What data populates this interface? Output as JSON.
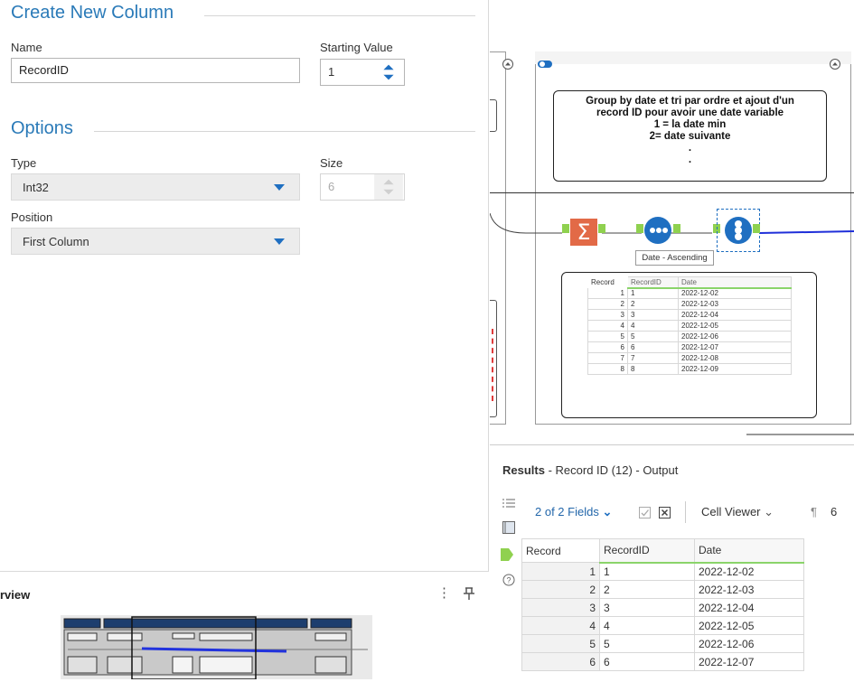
{
  "config": {
    "section1_title": "Create New Column",
    "name_label": "Name",
    "name_value": "RecordID",
    "starting_value_label": "Starting Value",
    "starting_value": "1",
    "section2_title": "Options",
    "type_label": "Type",
    "type_value": "Int32",
    "size_label": "Size",
    "size_value": "6",
    "position_label": "Position",
    "position_value": "First Column"
  },
  "overview": {
    "title": "rview",
    "more_icon": "⋮",
    "pin_icon": "pin-icon"
  },
  "canvas": {
    "comment_lines": [
      "Group by date et tri par ordre et ajout d'un",
      "record ID pour avoir une date variable",
      "1 = la date min",
      "2= date suivante",
      ".",
      "."
    ],
    "sort_tooltip": "Date - Ascending",
    "mini_table": {
      "headers": [
        "Record",
        "RecordID",
        "Date"
      ],
      "rows": [
        [
          "1",
          "1",
          "2022-12-02"
        ],
        [
          "2",
          "2",
          "2022-12-03"
        ],
        [
          "3",
          "3",
          "2022-12-04"
        ],
        [
          "4",
          "4",
          "2022-12-05"
        ],
        [
          "5",
          "5",
          "2022-12-06"
        ],
        [
          "6",
          "6",
          "2022-12-07"
        ],
        [
          "7",
          "7",
          "2022-12-08"
        ],
        [
          "8",
          "8",
          "2022-12-09"
        ]
      ]
    }
  },
  "results": {
    "title_bold": "Results",
    "title_rest": " - Record ID (12) - Output",
    "fields_label": "2 of 2 Fields",
    "cell_viewer_label": "Cell Viewer",
    "extra_label": "6",
    "headers": [
      "Record",
      "RecordID",
      "Date"
    ],
    "rows": [
      [
        "1",
        "1",
        "2022-12-02"
      ],
      [
        "2",
        "2",
        "2022-12-03"
      ],
      [
        "3",
        "3",
        "2022-12-04"
      ],
      [
        "4",
        "4",
        "2022-12-05"
      ],
      [
        "5",
        "5",
        "2022-12-06"
      ],
      [
        "6",
        "6",
        "2022-12-07"
      ]
    ]
  }
}
